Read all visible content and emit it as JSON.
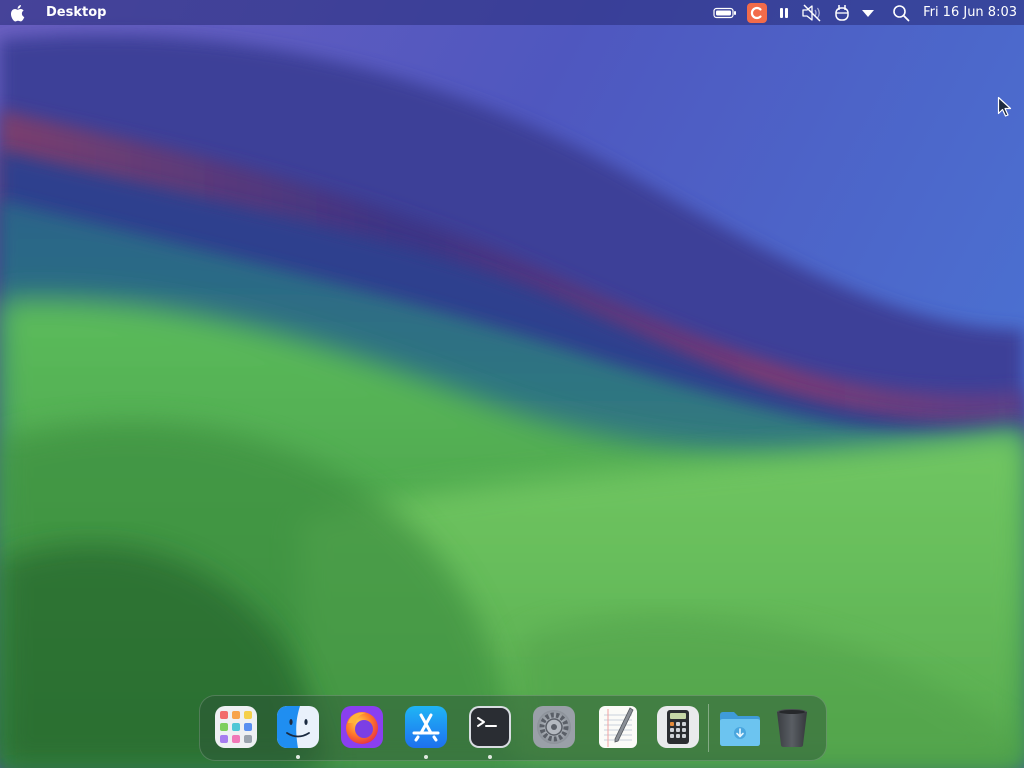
{
  "menubar": {
    "app_name": "Desktop",
    "clock": "Fri 16 Jun 8:03",
    "status_icons": [
      "battery-icon",
      "app-indicator-icon",
      "pause-icon",
      "muted-speaker-icon",
      "input-icon",
      "dropdown-icon",
      "search-icon"
    ]
  },
  "dock": {
    "items": [
      {
        "name": "launchpad",
        "icon": "launchpad-icon",
        "running": false
      },
      {
        "name": "finder",
        "icon": "finder-icon",
        "running": true
      },
      {
        "name": "firefox",
        "icon": "firefox-icon",
        "running": false
      },
      {
        "name": "app-store",
        "icon": "app-store-icon",
        "running": true
      },
      {
        "name": "terminal",
        "icon": "terminal-icon",
        "running": true
      },
      {
        "name": "system-settings",
        "icon": "settings-gear-icon",
        "running": false
      },
      {
        "name": "text-editor",
        "icon": "text-editor-icon",
        "running": false
      },
      {
        "name": "calculator",
        "icon": "calculator-icon",
        "running": false
      },
      {
        "name": "downloads",
        "icon": "downloads-folder-icon",
        "running": false
      },
      {
        "name": "trash",
        "icon": "trash-icon",
        "running": false
      }
    ]
  },
  "colors": {
    "menubar_bg": "#3a3f8c",
    "accent_orange": "#f26b4a",
    "app_store_blue": "#1e8ff0",
    "folder_blue": "#5ab6ea"
  }
}
